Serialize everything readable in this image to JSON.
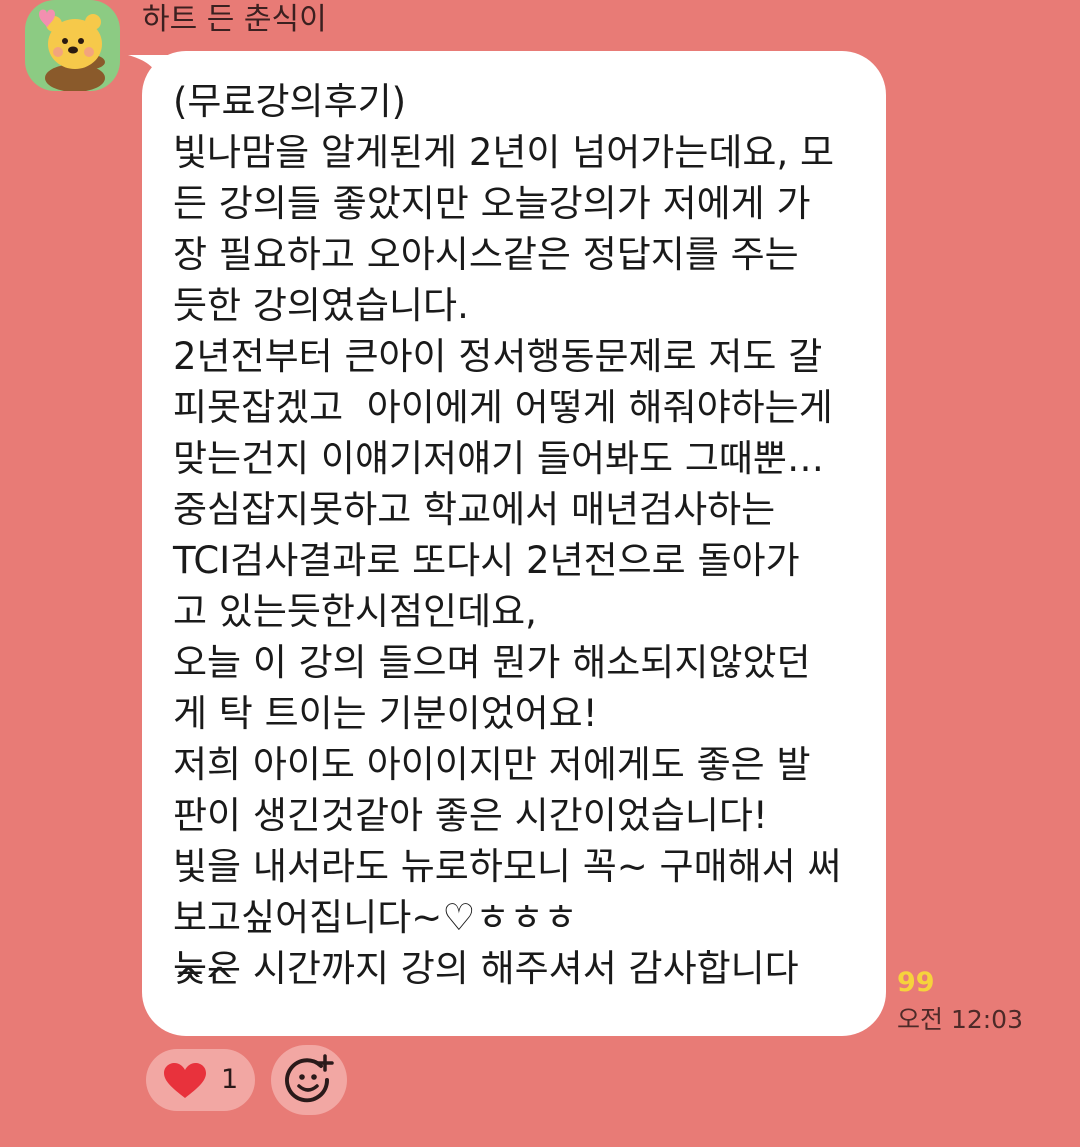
{
  "sender": {
    "name": "하트 든 춘식이"
  },
  "message": {
    "lines": [
      "(무료강의후기)",
      "빛나맘을 알게된게 2년이 넘어가는데요, 모",
      "든 강의들 좋았지만 오늘강의가 저에게 가",
      "장 필요하고 오아시스같은 정답지를 주는",
      "듯한 강의였습니다.",
      "2년전부터 큰아이 정서행동문제로 저도 갈",
      "피못잡겠고  아이에게 어떻게 해줘야하는게",
      "맞는건지 이얘기저얘기 들어봐도 그때뿐…",
      "중심잡지못하고 학교에서 매년검사하는",
      "TCI검사결과로 또다시 2년전으로 돌아가",
      "고 있는듯한시점인데요,",
      "오늘 이 강의 들으며 뭔가 해소되지않았던",
      "게 탁 트이는 기분이었어요!",
      "저희 아이도 아이이지만 저에게도 좋은 발",
      "판이 생긴것같아 좋은 시간이었습니다!",
      "빛을 내서라도 뉴로하모니 꼭~ 구매해서 써",
      "보고싶어집니다~♡ㅎㅎㅎ",
      "늦은 시간까지 강의 해주셔서 감사합니다",
      "^^"
    ],
    "unread_count": "99",
    "time": "오전 12:03"
  },
  "reactions": {
    "heart_count": "1",
    "heart_icon": "heart-icon",
    "add_icon": "add-emoji-icon"
  },
  "colors": {
    "background": "#E87B76",
    "bubble": "#FFFFFF",
    "unread": "#F6D33C",
    "heart": "#E8323C",
    "avatar_bg": "#8CCB83"
  }
}
